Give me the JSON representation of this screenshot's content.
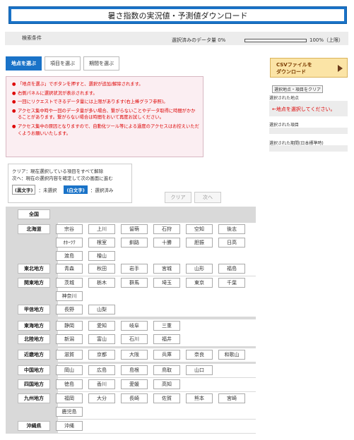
{
  "title": "暑さ指数の実況値・予測値ダウンロード",
  "conditions": {
    "label": "検索条件",
    "amount_label": "選択済みのデータ量 0%",
    "amount_percent": 0,
    "amount_max": "100%（上限）"
  },
  "tabs": [
    {
      "label": "地点を選ぶ",
      "active": true
    },
    {
      "label": "項目を選ぶ",
      "active": false
    },
    {
      "label": "期間を選ぶ",
      "active": false
    }
  ],
  "notice": [
    {
      "text": "「地点を選ぶ」でボタンを押すと、選択が追加/解除されます。",
      "color": "red"
    },
    {
      "text": "右側パネルに選択状況が表示されます。",
      "color": "red"
    },
    {
      "text": "一回にリクエストできるデータ量には上限があります(右上棒グラフ参照)。",
      "color": "red"
    },
    {
      "text": "アクセス集中時や一回のデータ量が多い場合、繋がらないことやデータ取得に時間がかかることがあります。繋がらない場合は時間をおいて再度お試しください。",
      "color": "red"
    },
    {
      "text": "アクセス集中の原因となりますので、自動化ツール等による過度のアクセスはお控えいただくようお願いいたします。",
      "color": "red"
    }
  ],
  "help": {
    "line1": "クリア：現在選択している項目をすべて解除",
    "line2": "次へ：現在の選択内容を確定して次の画面に進む",
    "black_chip": "(黒文字)",
    "black_desc": "：未選択",
    "white_chip": "(白文字)",
    "white_desc": "：選択済み"
  },
  "buttons": {
    "clear": "クリア",
    "next": "次へ"
  },
  "side": {
    "csv_line1": "CSVファイルを",
    "csv_line2": "ダウンロード",
    "clear_selection": "選択地点・項目をクリア",
    "selected_points_label": "選択された地点",
    "points_hint": "←地点を選択してください。",
    "selected_items_label": "選択された項目",
    "selected_period_label": "選択された期間(日本標準時)"
  },
  "regions": [
    {
      "name": "全国",
      "prefectures": []
    },
    {
      "name": "北海道",
      "prefectures": [
        "宗谷",
        "上川",
        "留萌",
        "石狩",
        "空知",
        "後志",
        "ｵﾎｰﾂｸ",
        "根室",
        "釧路",
        "十勝",
        "胆振",
        "日高",
        "渡島",
        "檜山"
      ]
    },
    {
      "name": "東北地方",
      "prefectures": [
        "青森",
        "秋田",
        "岩手",
        "宮城",
        "山形",
        "福島"
      ]
    },
    {
      "name": "関東地方",
      "prefectures": [
        "茨城",
        "栃木",
        "群馬",
        "埼玉",
        "東京",
        "千葉",
        "神奈川"
      ]
    },
    {
      "name": "甲信地方",
      "prefectures": [
        "長野",
        "山梨"
      ]
    },
    {
      "name": "東海地方",
      "prefectures": [
        "静岡",
        "愛知",
        "岐阜",
        "三重"
      ]
    },
    {
      "name": "北陸地方",
      "prefectures": [
        "新潟",
        "富山",
        "石川",
        "福井"
      ]
    },
    {
      "name": "近畿地方",
      "prefectures": [
        "滋賀",
        "京都",
        "大阪",
        "兵庫",
        "奈良",
        "和歌山"
      ]
    },
    {
      "name": "中国地方",
      "prefectures": [
        "岡山",
        "広島",
        "島根",
        "鳥取",
        "山口"
      ]
    },
    {
      "name": "四国地方",
      "prefectures": [
        "徳島",
        "香川",
        "愛媛",
        "高知"
      ]
    },
    {
      "name": "九州地方",
      "prefectures": [
        "福岡",
        "大分",
        "長崎",
        "佐賀",
        "熊本",
        "宮崎",
        "鹿児島"
      ]
    },
    {
      "name": "沖縄県",
      "prefectures": [
        "沖縄"
      ]
    }
  ]
}
